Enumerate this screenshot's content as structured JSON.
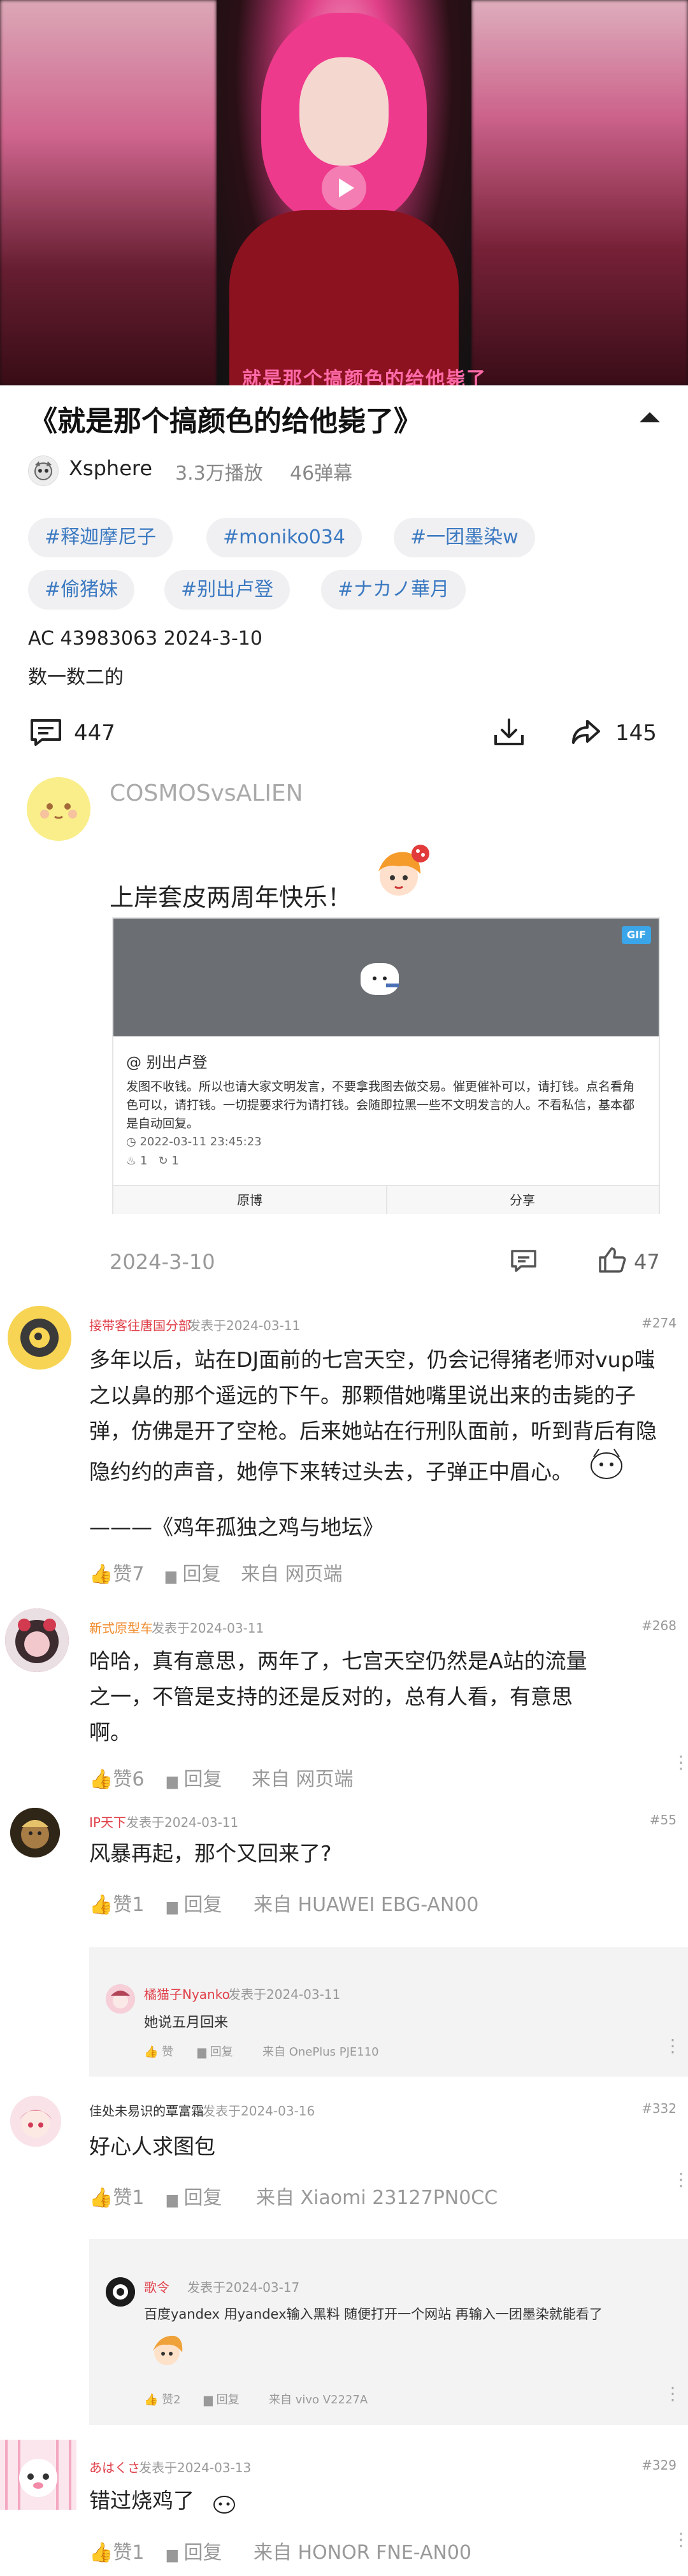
{
  "video": {
    "subtitle": "就是那个搞颜色的给他毙了"
  },
  "title": "《就是那个搞颜色的给他毙了》",
  "uploader": {
    "name": "Xsphere",
    "plays": "3.3万播放",
    "danmaku": "46弹幕"
  },
  "tags": [
    "#释迦摩尼子",
    "#moniko034",
    "#一团墨染w",
    "#偷猪妹",
    "#别出卢登",
    "#ナカノ華月"
  ],
  "meta": "AC 43983063   2024-3-10",
  "description": "数一数二的",
  "actions": {
    "comments": "447",
    "shares": "145"
  },
  "top_comment": {
    "name": "COSMOSvsALIEN",
    "text": "上岸套皮两周年快乐！",
    "date": "2024-3-10",
    "likes": "47",
    "card": {
      "gif": "GIF",
      "author": "@ 别出卢登",
      "body": "发图不收钱。所以也请大家文明发言，不要拿我图去做交易。催更催补可以，请打钱。点名看角色可以，请打钱。一切提要求行为请打钱。会随即拉黑一些不文明发言的人。不看私信，基本都是自动回复。",
      "time": "2022-03-11 23:45:23",
      "likes": "1",
      "shares": "1",
      "btn_repost": "原博",
      "btn_share": "分享"
    }
  },
  "comments": [
    {
      "user": "接带客往唐国分部",
      "posted": "发表于2024-03-11",
      "floor": "#274",
      "lines": [
        "多年以后，站在DJ面前的七宫天空，仍会记得猪老师对vup嗤",
        "之以鼻的那个遥远的下午。那颗借她嘴里说出来的击毙的子",
        "弹，仿佛是开了空枪。后来她站在行刑队面前，听到背后有隐",
        "隐约约的声音，她停下来转过头去，子弹正中眉心。",
        "———《鸡年孤独之鸡与地坛》"
      ],
      "like": "赞7",
      "reply": "回复",
      "source": "来自 网页端"
    },
    {
      "user": "新式原型车",
      "posted": "发表于2024-03-11",
      "floor": "#268",
      "lines": [
        "哈哈，真有意思，两年了，七宫天空仍然是A站的流量",
        "之一，不管是支持的还是反对的，总有人看，有意思",
        "啊。"
      ],
      "like": "赞6",
      "reply": "回复",
      "source": "来自 网页端"
    },
    {
      "user": "IP天下",
      "posted": "发表于2024-03-11",
      "floor": "#55",
      "lines": [
        "风暴再起，那个又回来了?"
      ],
      "like": "赞1",
      "reply": "回复",
      "source": "来自 HUAWEI   EBG-AN00",
      "sub": {
        "user": "橘猫子Nyanko",
        "posted": "发表于2024-03-11",
        "text": "她说五月回来",
        "like": "赞",
        "reply": "回复",
        "source": "来自 OnePlus  PJE110"
      }
    },
    {
      "user": "佳处未易识的覃富霜",
      "posted": "发表于2024-03-16",
      "floor": "#332",
      "lines": [
        "好心人求图包"
      ],
      "like": "赞1",
      "reply": "回复",
      "source": "来自 Xiaomi   23127PN0CC",
      "sub": {
        "user": "歌令",
        "posted": "发表于2024-03-17",
        "text": "百度yandex  用yandex输入黑料  随便打开一个网站  再输入一团墨染就能看了",
        "like": "赞2",
        "reply": "回复",
        "source": "来自 vivo  V2227A"
      }
    },
    {
      "user": "あはくさ",
      "posted": "发表于2024-03-13",
      "floor": "#329",
      "lines": [
        "错过烧鸡了"
      ],
      "like": "赞1",
      "reply": "回复",
      "source": "来自 HONOR   FNE-AN00"
    }
  ],
  "colors": {
    "tag_text": "#3b79c1",
    "username_red": "#e0404a",
    "username_orange": "#f08a2a"
  }
}
